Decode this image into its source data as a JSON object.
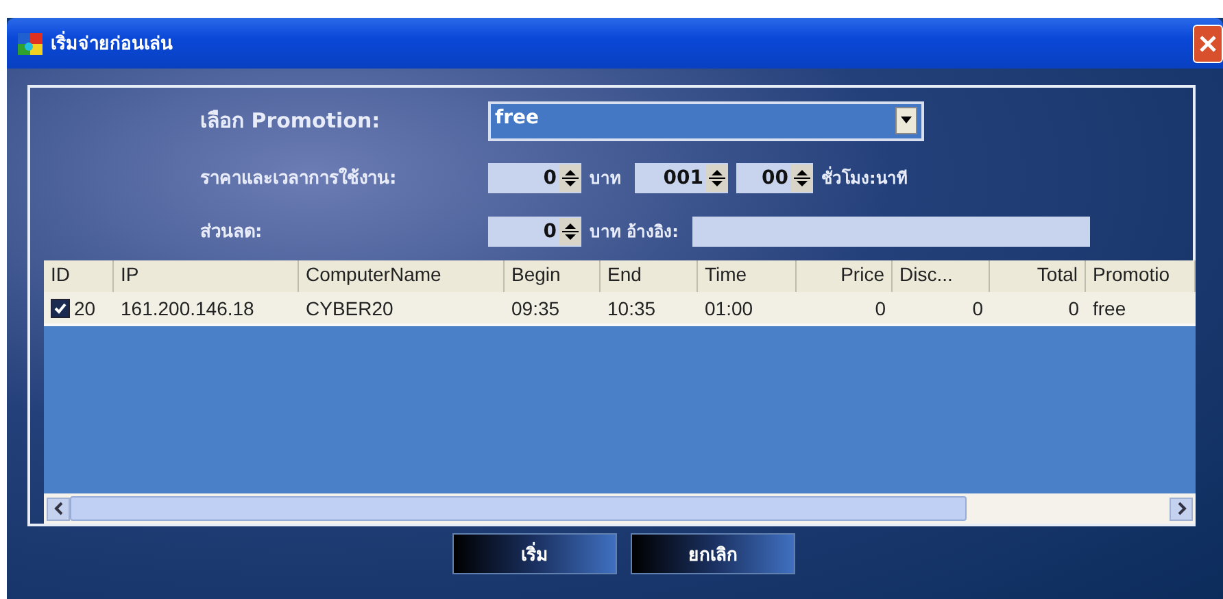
{
  "window": {
    "title": "เริ่มจ่ายก่อนเล่น"
  },
  "form": {
    "promotion_label": "เลือก Promotion:",
    "promotion_value": "free",
    "price_label": "ราคาและเวลาการใช้งาน:",
    "price_value": "0",
    "price_unit": "บาท",
    "hours_value": "001",
    "minutes_value": "00",
    "time_unit": "ชั่วโมง:นาที",
    "discount_label": "ส่วนลด:",
    "discount_value": "0",
    "discount_unit": "บาท อ้างอิง:"
  },
  "table": {
    "columns": [
      "ID",
      "IP",
      "ComputerName",
      "Begin",
      "End",
      "Time",
      "Price",
      "Disc...",
      "Total",
      "Promotio"
    ],
    "rows": [
      {
        "checked": true,
        "cells": [
          "20",
          "161.200.146.18",
          "CYBER20",
          "09:35",
          "10:35",
          "01:00",
          "0",
          "0",
          "0",
          "free"
        ]
      }
    ]
  },
  "buttons": [
    "เริ่ม",
    "ยกเลิก"
  ]
}
